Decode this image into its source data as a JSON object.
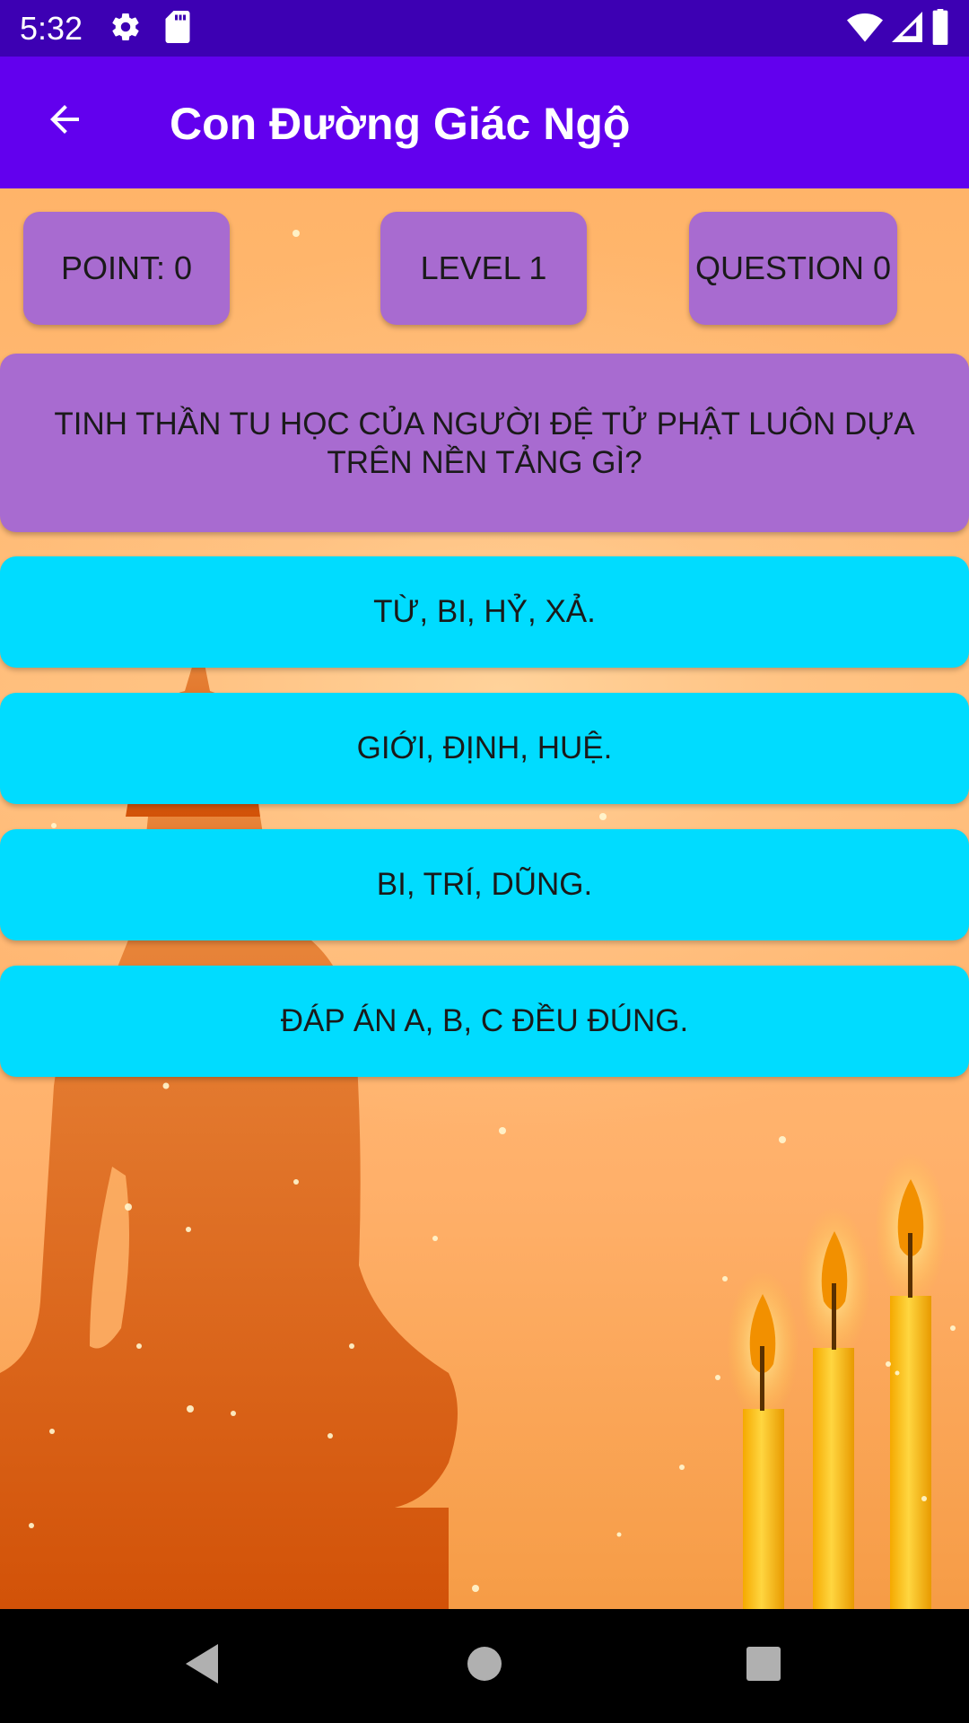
{
  "status_bar": {
    "time": "5:32",
    "left_icons": [
      "settings-icon",
      "sd-card-icon"
    ],
    "right_icons": [
      "wifi-icon",
      "signal-icon",
      "battery-icon"
    ]
  },
  "app_bar": {
    "back_icon": "arrow-back-icon",
    "title": "Con Đường Giác Ngộ"
  },
  "stats": {
    "point": "POINT: 0",
    "level": "LEVEL 1",
    "question": "QUESTION 0"
  },
  "question": {
    "text": "TINH THẦN TU HỌC CỦA NGƯỜI ĐỆ TỬ PHẬT LUÔN DỰA TRÊN NỀN TẢNG GÌ?"
  },
  "answers": [
    {
      "label": "TỪ, BI, HỶ, XẢ."
    },
    {
      "label": "GIỚI, ĐỊNH, HUỆ."
    },
    {
      "label": "BI, TRÍ, DŨNG."
    },
    {
      "label": "ĐÁP ÁN A, B, C ĐỀU ĐÚNG."
    }
  ],
  "nav_bar": {
    "icons": [
      "back-triangle-icon",
      "home-circle-icon",
      "recents-square-icon"
    ]
  },
  "colors": {
    "status_bar": "#3d00b3",
    "app_bar": "#6200ee",
    "stat_pill": "#a86bd0",
    "answer_button": "#00dcff",
    "background": "#f7a24a"
  }
}
